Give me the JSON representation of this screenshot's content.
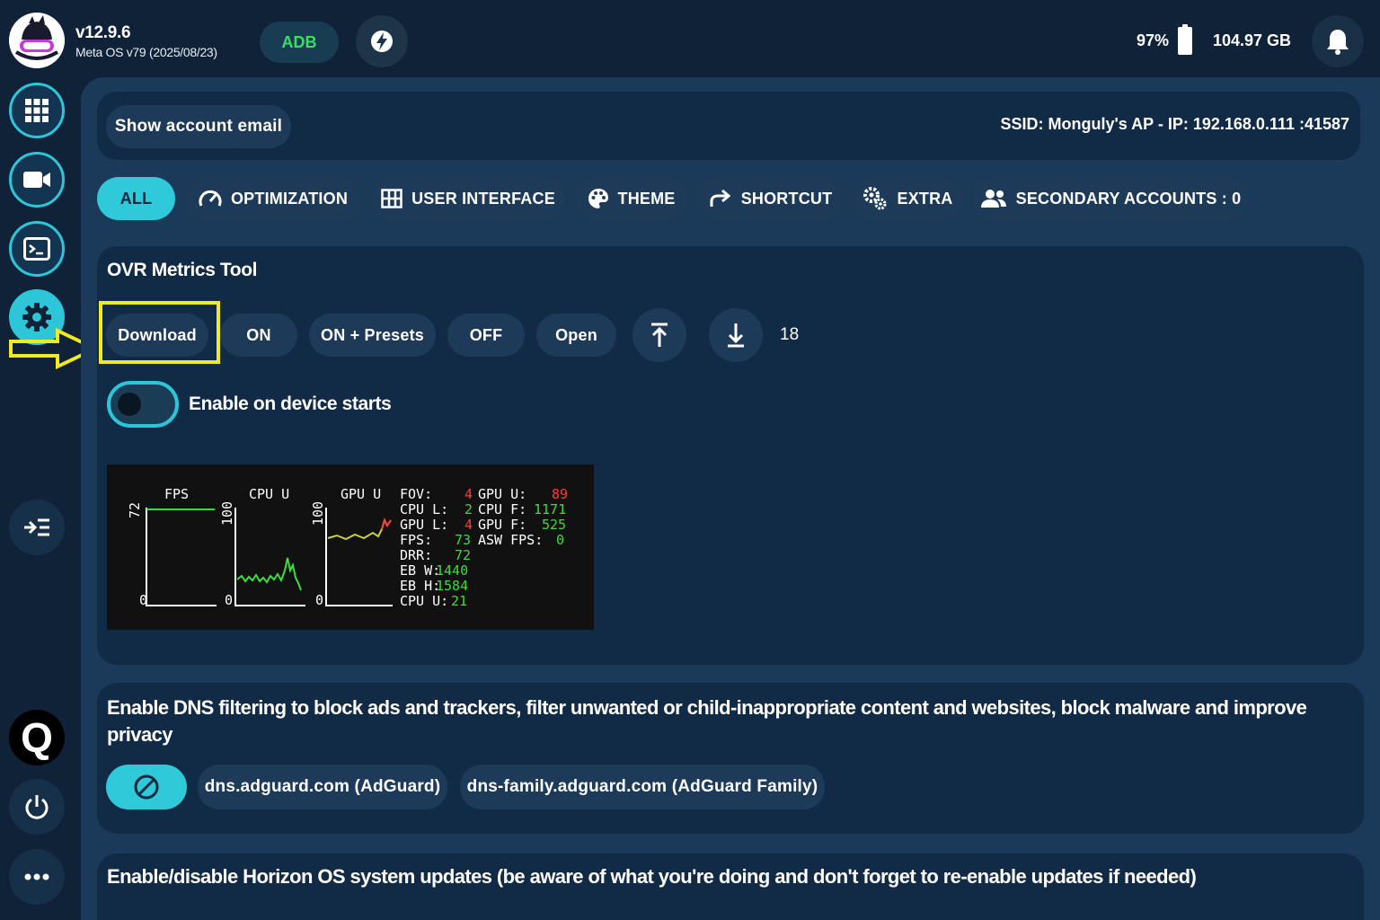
{
  "header": {
    "version": "v12.9.6",
    "os_version": "Meta OS v79 (2025/08/23)",
    "adb_label": "ADB",
    "adb_color": "#3ddc67",
    "battery_percent": "97%",
    "storage": "104.97 GB"
  },
  "sidebar": {
    "icons": [
      "apps-grid-icon",
      "video-camera-icon",
      "terminal-icon",
      "gear-icon",
      "collapse-menu-icon",
      "q-logo",
      "power-icon",
      "more-icon"
    ],
    "active": "gear-icon",
    "q_label": "Q"
  },
  "account": {
    "show_email_label": "Show account email",
    "ssid": "SSID: Monguly's AP - IP: 192.168.0.111 :41587"
  },
  "tabs": [
    {
      "label": "ALL",
      "icon": null
    },
    {
      "label": "OPTIMIZATION",
      "icon": "speedometer-icon"
    },
    {
      "label": "USER INTERFACE",
      "icon": "grid-icon"
    },
    {
      "label": "THEME",
      "icon": "palette-icon"
    },
    {
      "label": "SHORTCUT",
      "icon": "share-arrow-icon"
    },
    {
      "label": "EXTRA",
      "icon": "gears-icon"
    },
    {
      "label": "SECONDARY ACCOUNTS : 0",
      "icon": "users-icon"
    }
  ],
  "active_tab": "ALL",
  "accent_color": "#2fc9d9",
  "highlight_color": "#f2ea20",
  "ovr": {
    "title": "OVR Metrics Tool",
    "buttons": [
      "Download",
      "ON",
      "ON + Presets",
      "OFF",
      "Open"
    ],
    "upload_icon": "upload-icon",
    "download_icon": "download-icon",
    "count": "18",
    "toggle_label": "Enable on device starts",
    "toggle_on": false,
    "metrics": {
      "graph_labels": [
        "FPS",
        "CPU U",
        "GPU U"
      ],
      "graph_max": [
        "72",
        "100",
        "100"
      ],
      "graph_min": [
        "0",
        "0",
        "0"
      ],
      "stats_left": [
        {
          "label": "FOV:",
          "value": "4",
          "color": "#ff3b3b"
        },
        {
          "label": "CPU L:",
          "value": "2",
          "color": "#3ddc3d"
        },
        {
          "label": "GPU L:",
          "value": "4",
          "color": "#ff3b3b"
        },
        {
          "label": "FPS:",
          "value": "73",
          "color": "#3ddc3d"
        },
        {
          "label": "DRR:",
          "value": "72",
          "color": "#3ddc3d"
        },
        {
          "label": "EB W:",
          "value": "1440",
          "color": "#3ddc3d"
        },
        {
          "label": "EB H:",
          "value": "1584",
          "color": "#3ddc3d"
        },
        {
          "label": "CPU U:",
          "value": "21",
          "color": "#3ddc3d"
        }
      ],
      "stats_right": [
        {
          "label": "GPU U:",
          "value": "89",
          "color": "#ff3b3b"
        },
        {
          "label": "CPU F:",
          "value": "1171",
          "color": "#3ddc3d"
        },
        {
          "label": "GPU F:",
          "value": "525",
          "color": "#3ddc3d"
        },
        {
          "label": "ASW FPS:",
          "value": "0",
          "color": "#3ddc3d"
        }
      ]
    }
  },
  "dns": {
    "description": "Enable DNS filtering to block ads and trackers, filter unwanted or child-inappropriate content and websites, block malware and improve privacy",
    "options": [
      "dns.adguard.com (AdGuard)",
      "dns-family.adguard.com (AdGuard Family)"
    ]
  },
  "updates": {
    "description": "Enable/disable Horizon OS system updates (be aware of what you're doing and don't forget to re-enable updates if needed)"
  }
}
